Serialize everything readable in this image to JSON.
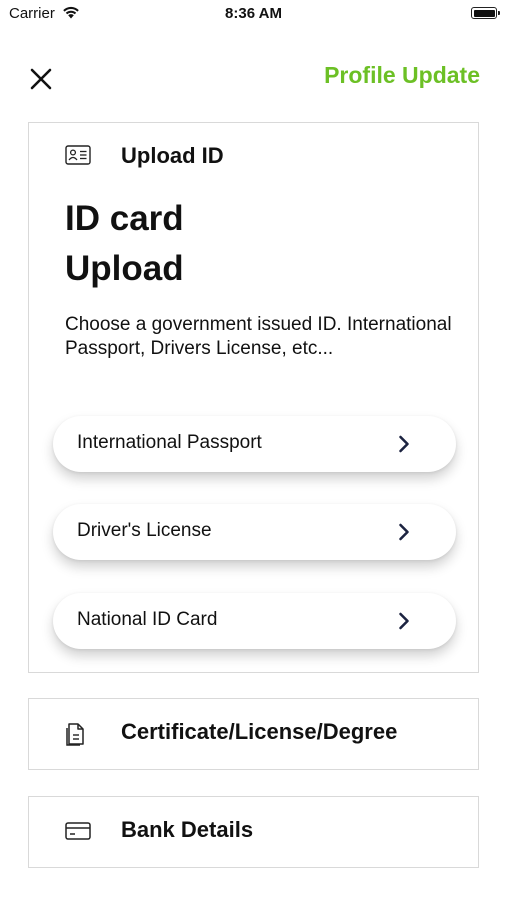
{
  "status_bar": {
    "carrier": "Carrier",
    "time": "8:36 AM"
  },
  "header": {
    "title": "Profile Update",
    "close_icon": "close-icon",
    "accent_color": "#6cc025"
  },
  "upload_id": {
    "section_title": "Upload ID",
    "icon": "id-card-icon",
    "heading_line1": "ID card",
    "heading_line2": "Upload",
    "description": "Choose a government issued ID. International Passport, Drivers License, etc...",
    "options": [
      {
        "label": "International Passport",
        "icon": "chevron-right-icon"
      },
      {
        "label": "Driver's License",
        "icon": "chevron-right-icon"
      },
      {
        "label": "National ID Card",
        "icon": "chevron-right-icon"
      }
    ]
  },
  "certificate": {
    "title": "Certificate/License/Degree",
    "icon": "document-icon"
  },
  "bank": {
    "title": "Bank Details",
    "icon": "credit-card-icon"
  }
}
